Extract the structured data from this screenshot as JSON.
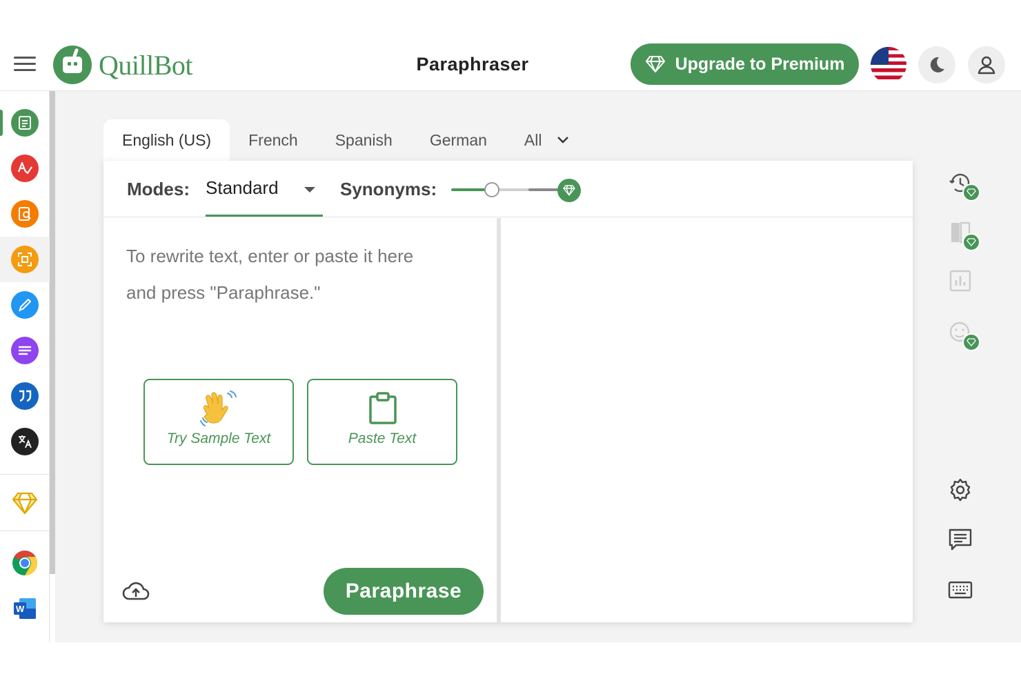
{
  "header": {
    "brand": "QuillBot",
    "page_title": "Paraphraser",
    "upgrade_label": "Upgrade to Premium",
    "language_flag": "us-flag-icon",
    "accent_color": "#499557"
  },
  "sidebar": {
    "items": [
      {
        "name": "paraphraser",
        "icon": "paraphraser-icon",
        "color": "#499557",
        "active": true
      },
      {
        "name": "grammar-checker",
        "icon": "grammar-check-icon",
        "color": "#e53935"
      },
      {
        "name": "plagiarism-checker",
        "icon": "plagiarism-icon",
        "color": "#f57c00"
      },
      {
        "name": "ai-detector",
        "icon": "ai-detector-icon",
        "color": "#f39c12"
      },
      {
        "name": "co-writer",
        "icon": "pen-icon",
        "color": "#2196f3"
      },
      {
        "name": "summarizer",
        "icon": "summarizer-icon",
        "color": "#8e44ef"
      },
      {
        "name": "citation-generator",
        "icon": "quote-icon",
        "color": "#1565c0"
      },
      {
        "name": "translator",
        "icon": "translate-icon",
        "color": "#222222"
      }
    ],
    "premium_icon": "diamond-icon",
    "extensions": [
      "chrome-icon",
      "word-icon"
    ]
  },
  "tabs": {
    "items": [
      "English (US)",
      "French",
      "Spanish",
      "German",
      "All"
    ],
    "active": "English (US)"
  },
  "modes": {
    "label": "Modes:",
    "selected": "Standard",
    "synonyms_label": "Synonyms:",
    "synonyms_level": 0.35
  },
  "editor": {
    "placeholder_line1": "To rewrite text, enter or paste it here",
    "placeholder_line2": "and press \"Paraphrase.\"",
    "sample_button": "Try Sample Text",
    "paste_button": "Paste Text",
    "paraphrase_button": "Paraphrase"
  },
  "right_tools": [
    "history-icon",
    "compare-icon",
    "statistics-icon",
    "tone-icon",
    "settings-icon",
    "feedback-icon",
    "keyboard-icon"
  ]
}
